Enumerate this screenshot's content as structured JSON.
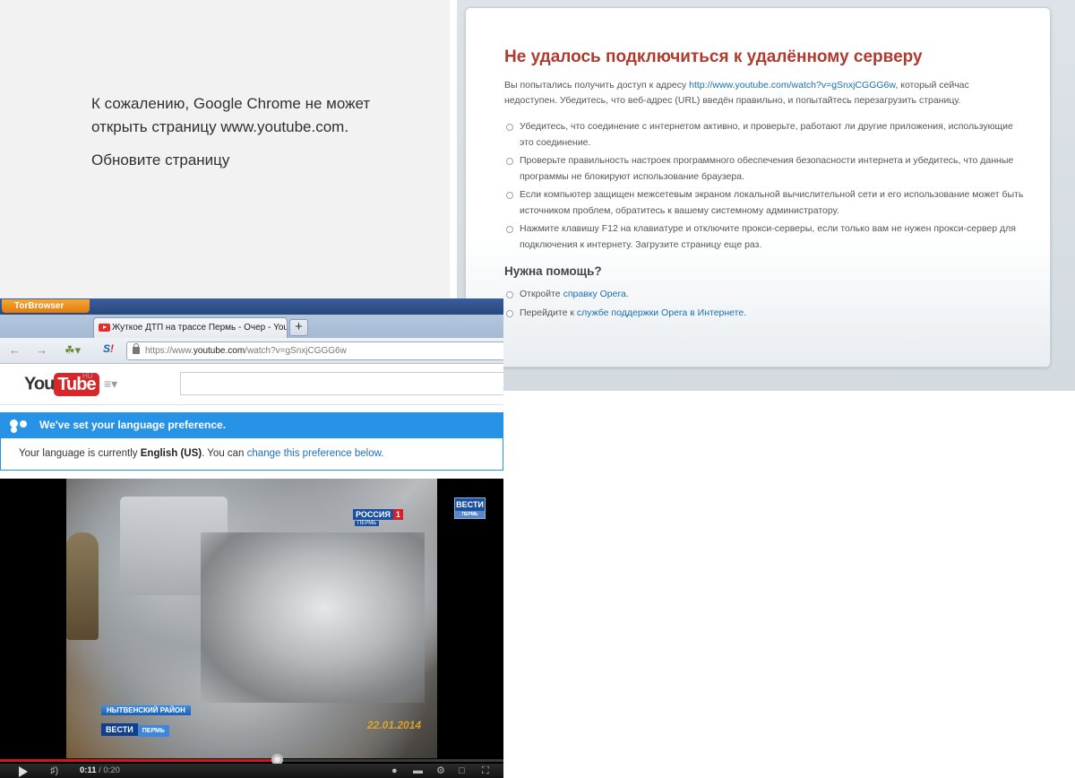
{
  "chrome": {
    "message": "К сожалению, Google Chrome не может открыть страницу www.youtube.com.",
    "reload": "Обновите страницу"
  },
  "opera": {
    "title": "Не удалось подключиться к удалённому серверу",
    "intro_before": "Вы попытались получить доступ к адресу ",
    "intro_link": "http://www.youtube.com/watch?v=gSnxjCGGG6w",
    "intro_after": ", который сейчас недоступен. Убедитесь, что веб-адрес (URL) введён правильно, и попытайтесь перезагрузить страницу.",
    "tips": [
      "Убедитесь, что соединение с интернетом активно, и проверьте, работают ли другие приложения, использующие это соединение.",
      "Проверьте правильность настроек программного обеспечения безопасности интернета и убедитесь, что данные программы не блокируют использование браузера.",
      "Если компьютер защищен межсетевым экраном локальной вычислительной сети и его использование может быть источником проблем, обратитесь к вашему системному администратору.",
      "Нажмите клавишу F12 на клавиатуре и отключите прокси-серверы, если только вам не нужен прокси-сервер для подключения к интернету. Загрузите страницу еще раз."
    ],
    "help_title": "Нужна помощь?",
    "help1_before": "Откройте ",
    "help1_link": "справку Opera",
    "help1_after": ".",
    "help2_before": "Перейдите к ",
    "help2_link": "службе поддержки Opera в Интернете",
    "help2_after": "."
  },
  "tor": {
    "menu_label": "TorBrowser",
    "tab_title": "Жуткое ДТП на трассе Пермь - Очер - You...",
    "new_tab": "+",
    "url_prefix": "https://www.",
    "url_host": "youtube.com",
    "url_path": "/watch?v=gSnxjCGGG6w"
  },
  "youtube": {
    "logo_you": "You",
    "logo_tube": "Tube",
    "region": "HU",
    "lang_banner": "We've set your language preference.",
    "lang_text_before": "Your language is currently ",
    "lang_current": "English (US)",
    "lang_text_mid": ". You can ",
    "lang_link": "change this preference below."
  },
  "video": {
    "channel_a": "РОССИЯ",
    "channel_b": "1",
    "channel_sub": "ПЕРМЬ",
    "vesti": "ВЕСТИ",
    "vesti_sub": "ПЕРМЬ",
    "location": "НЫТВЕНСКИЙ РАЙОН",
    "tag_v": "ВЕСТИ",
    "tag_p": "ПЕРМЬ",
    "date": "22.01.2014",
    "time_current": "0:11",
    "time_total": " / 0:20",
    "progress_fraction": 0.55
  }
}
